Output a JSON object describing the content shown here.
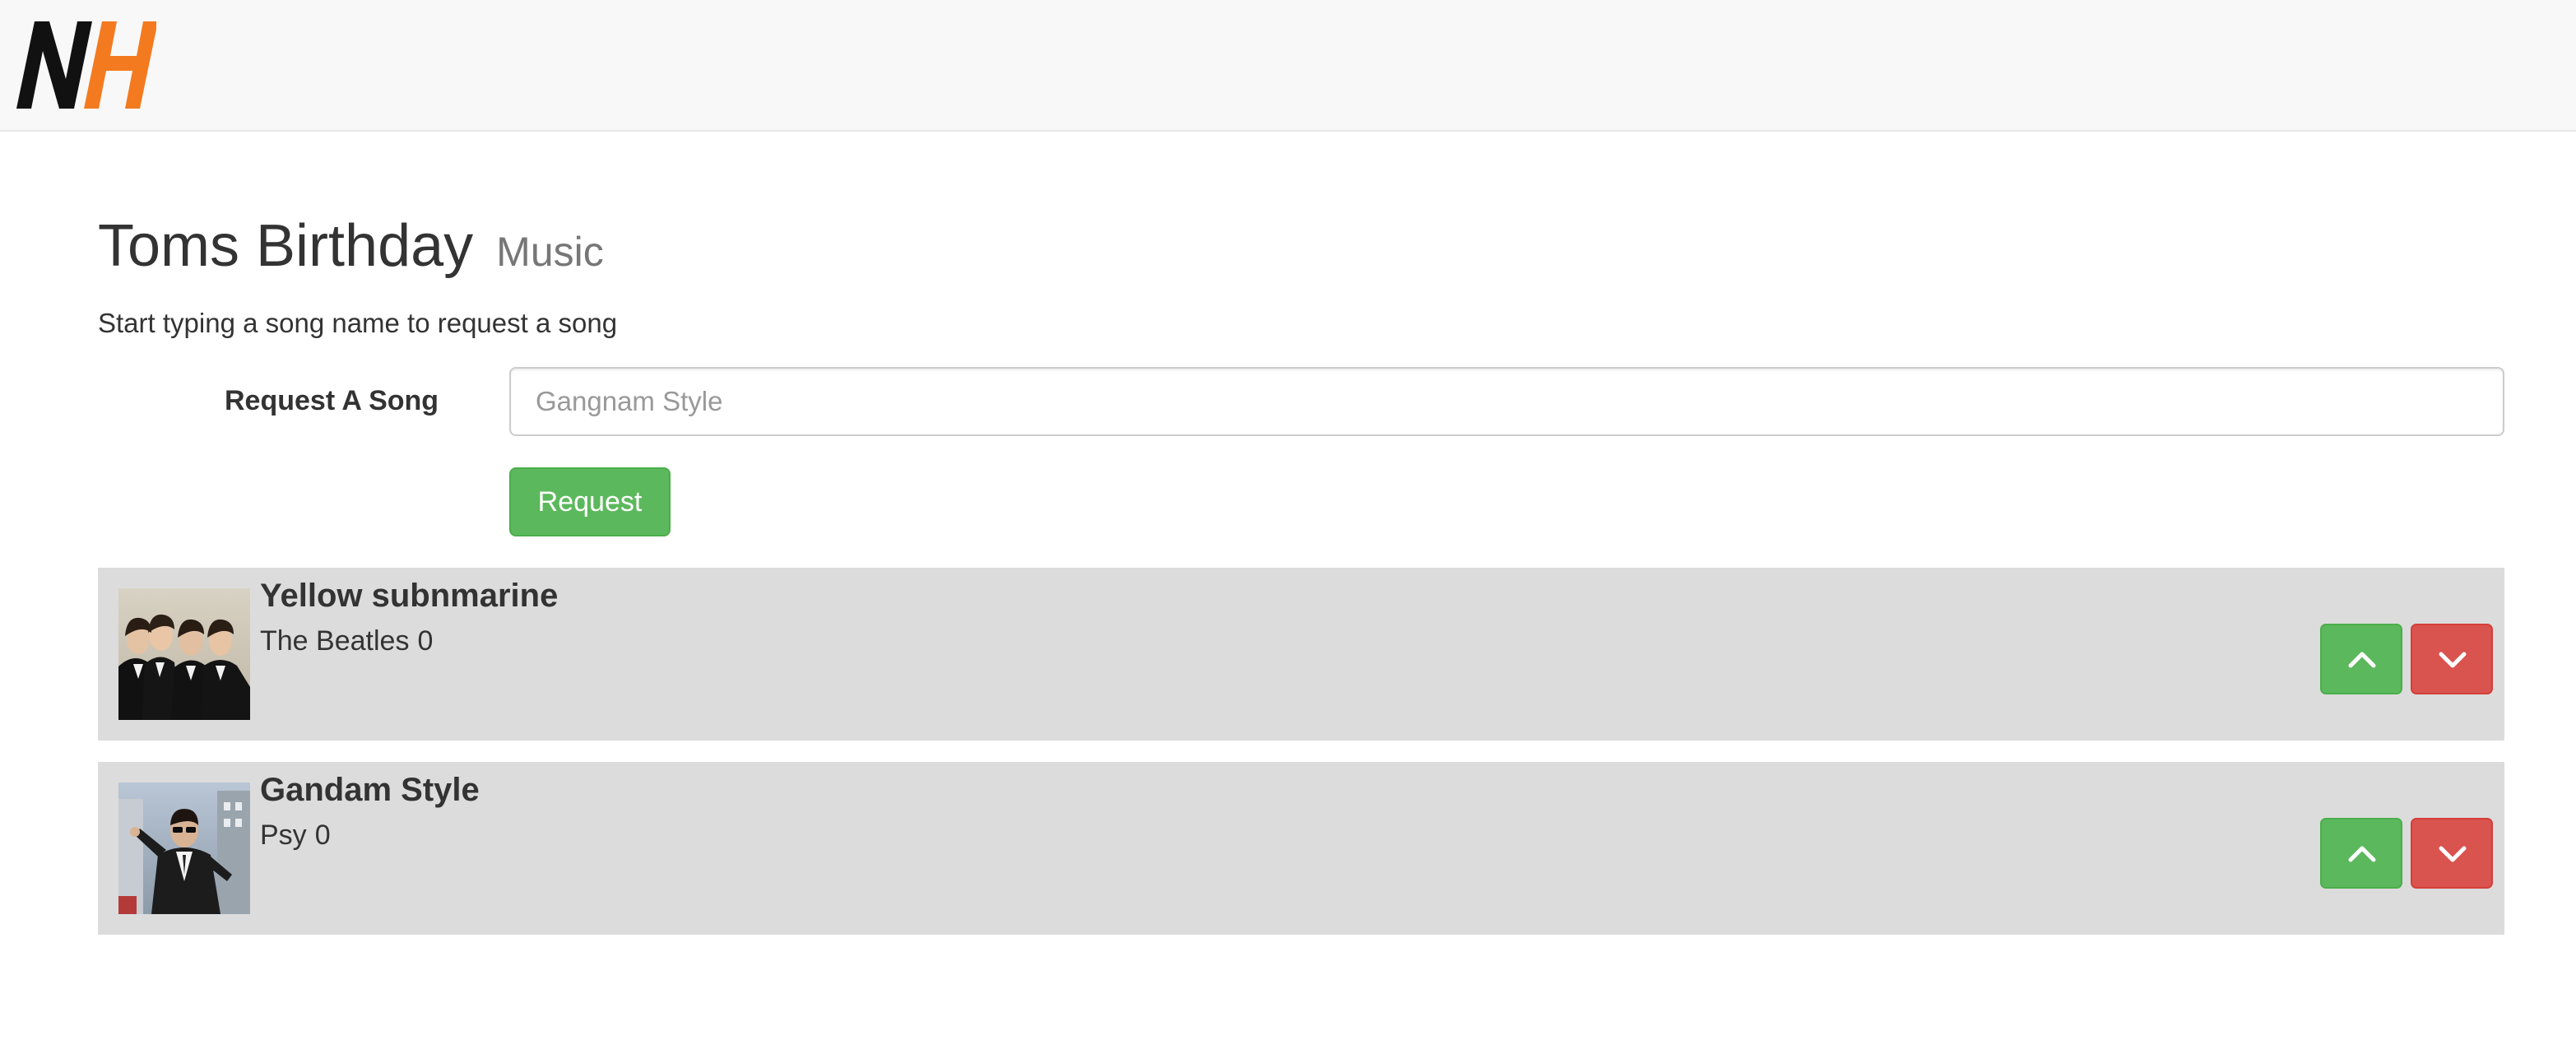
{
  "app": {
    "brand": {
      "logo_letters": "NH",
      "colors": {
        "n": "#111111",
        "h": "#f47a20"
      }
    }
  },
  "page": {
    "title": "Toms Birthday",
    "subtitle": "Music",
    "intro": "Start typing a song name to request a song"
  },
  "request_form": {
    "label": "Request A Song",
    "placeholder": "Gangnam Style",
    "value": "",
    "button_label": "Request"
  },
  "songs": [
    {
      "title": "Yellow subnmarine",
      "artist": "The Beatles",
      "votes": "0",
      "thumbnail": "band-photo",
      "upvote_icon": "chevron-up-icon",
      "downvote_icon": "chevron-down-icon"
    },
    {
      "title": "Gandam Style",
      "artist": "Psy",
      "votes": "0",
      "thumbnail": "artist-photo",
      "upvote_icon": "chevron-up-icon",
      "downvote_icon": "chevron-down-icon"
    }
  ],
  "colors": {
    "success": "#5cb85c",
    "danger": "#d9534f",
    "row_bg": "#dcdcdc",
    "navbar_bg": "#f8f8f8"
  }
}
